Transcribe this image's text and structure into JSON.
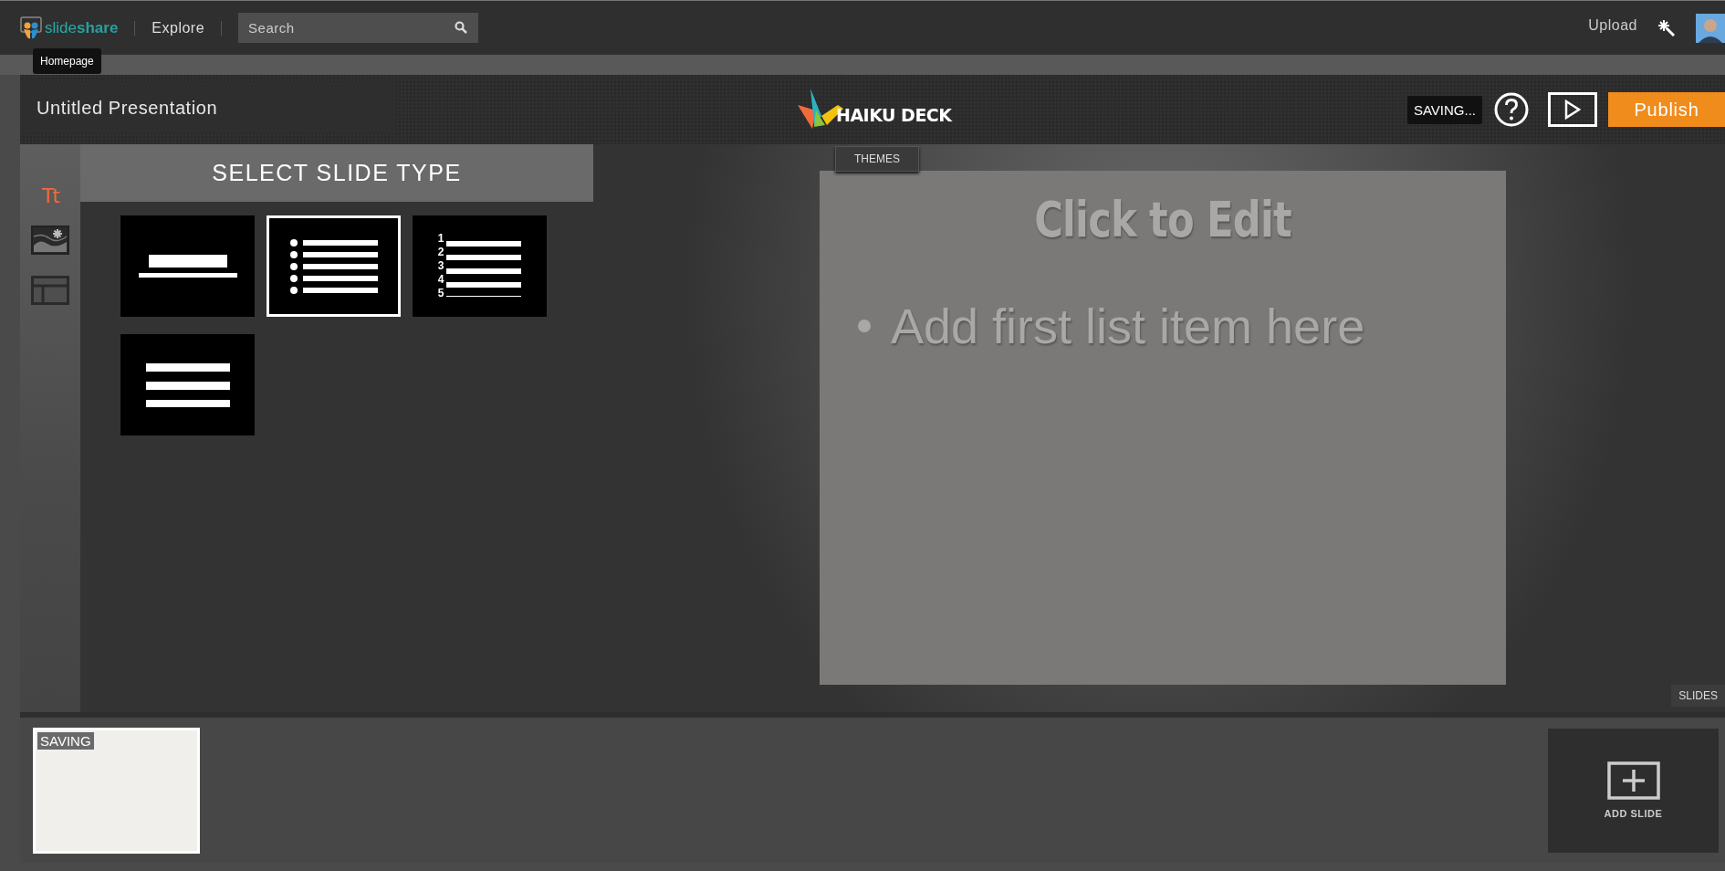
{
  "topbar": {
    "logo_text": "slide**share**",
    "tooltip": "Homepage",
    "nav": "Explore",
    "search": {
      "placeholder": "Search"
    },
    "upload": "Upload"
  },
  "header": {
    "title": "Untitled Presentation",
    "logo_text": "HAIKU DECK",
    "status": "SAVING...",
    "publish": "Publish"
  },
  "tools": [
    {
      "kind": "text",
      "label": "Tt",
      "selected": true
    },
    {
      "kind": "image",
      "selected": false
    },
    {
      "kind": "layout",
      "selected": false
    }
  ],
  "panel": {
    "heading": "SELECT SLIDE TYPE",
    "slide_types": [
      {
        "kind": "title",
        "selected": false
      },
      {
        "kind": "bullets",
        "selected": true
      },
      {
        "kind": "numbered",
        "selected": false,
        "numbers": [
          "1",
          "2",
          "3",
          "4",
          "5"
        ]
      },
      {
        "kind": "paragraph",
        "selected": false
      }
    ]
  },
  "themes_tab": "THEMES",
  "slide": {
    "title": "Click to Edit",
    "items": [
      "Add first list item here"
    ]
  },
  "slides_tab": "SLIDES",
  "thumbnails": [
    {
      "badge": "SAVING"
    }
  ],
  "add_slide": "ADD SLIDE"
}
